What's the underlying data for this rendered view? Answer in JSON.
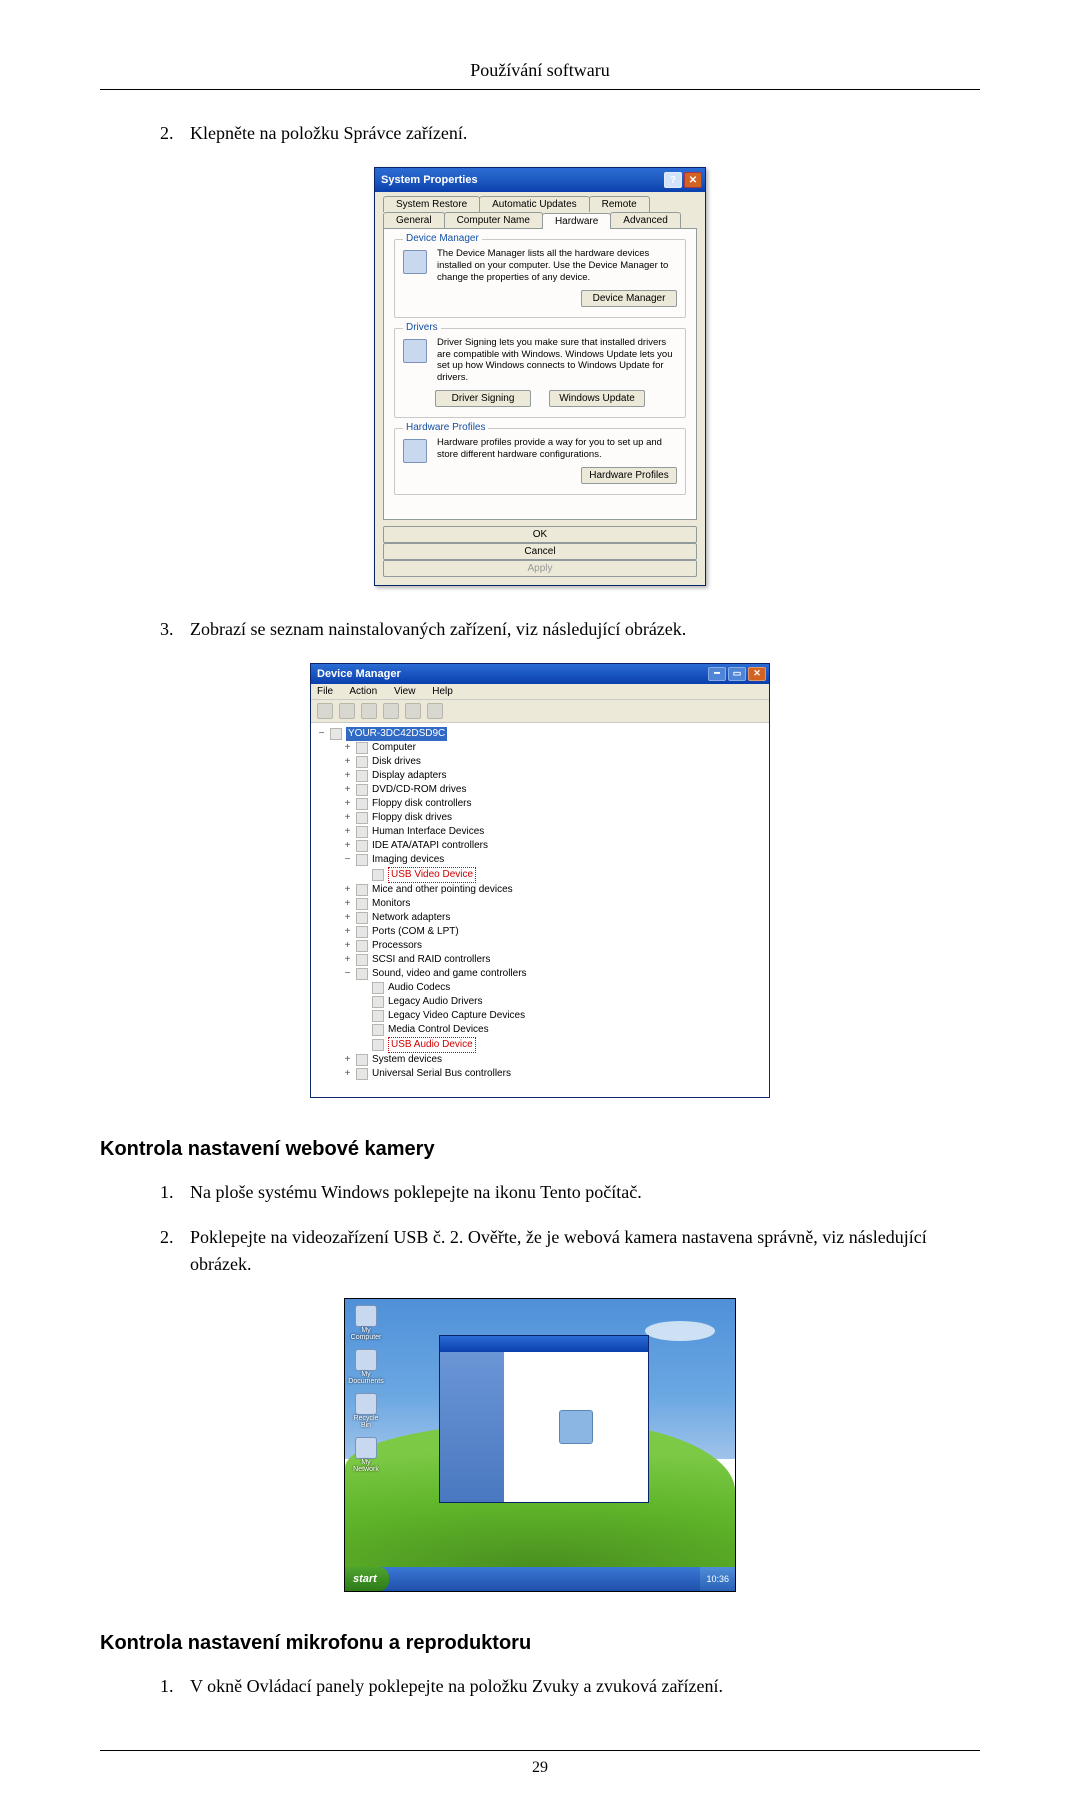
{
  "header": "Používání softwaru",
  "step2": "Klepněte na položku Správce zařízení.",
  "sysprop": {
    "title": "System Properties",
    "tabs_row1": [
      "System Restore",
      "Automatic Updates",
      "Remote"
    ],
    "tabs_row2": [
      "General",
      "Computer Name",
      "Hardware",
      "Advanced"
    ],
    "active_tab": "Hardware",
    "group_devmgr": {
      "label": "Device Manager",
      "text": "The Device Manager lists all the hardware devices installed on your computer. Use the Device Manager to change the properties of any device.",
      "button": "Device Manager"
    },
    "group_drivers": {
      "label": "Drivers",
      "text": "Driver Signing lets you make sure that installed drivers are compatible with Windows. Windows Update lets you set up how Windows connects to Windows Update for drivers.",
      "btn1": "Driver Signing",
      "btn2": "Windows Update"
    },
    "group_hwp": {
      "label": "Hardware Profiles",
      "text": "Hardware profiles provide a way for you to set up and store different hardware configurations.",
      "button": "Hardware Profiles"
    },
    "dlg": {
      "ok": "OK",
      "cancel": "Cancel",
      "apply": "Apply"
    }
  },
  "step3": "Zobrazí se seznam nainstalovaných zařízení, viz následující obrázek.",
  "devmgr": {
    "title": "Device Manager",
    "menu": [
      "File",
      "Action",
      "View",
      "Help"
    ],
    "root": "YOUR-3DC42DSD9C",
    "items": [
      "Computer",
      "Disk drives",
      "Display adapters",
      "DVD/CD-ROM drives",
      "Floppy disk controllers",
      "Floppy disk drives",
      "Human Interface Devices",
      "IDE ATA/ATAPI controllers",
      "Imaging devices"
    ],
    "usb_video": "USB Video Device",
    "items2": [
      "Mice and other pointing devices",
      "Monitors",
      "Network adapters",
      "Ports (COM & LPT)",
      "Processors",
      "SCSI and RAID controllers",
      "Sound, video and game controllers"
    ],
    "svg_children": [
      "Audio Codecs",
      "Legacy Audio Drivers",
      "Legacy Video Capture Devices",
      "Media Control Devices"
    ],
    "usb_audio": "USB Audio Device",
    "items3": [
      "System devices",
      "Universal Serial Bus controllers"
    ]
  },
  "section_camera_heading": "Kontrola nastavení webové kamery",
  "camera_step1": "Na ploše systému Windows poklepejte na ikonu Tento počítač.",
  "camera_step2": "Poklepejte na videozařízení USB č. 2. Ověřte, že je webová kamera nastavena správně, viz následující obrázek.",
  "xp": {
    "start": "start",
    "time": "10:36",
    "icons": [
      "My Computer",
      "My Documents",
      "Recycle Bin",
      "My Network"
    ]
  },
  "section_mic_heading": "Kontrola nastavení mikrofonu a reproduktoru",
  "mic_step1": "V okně Ovládací panely poklepejte na položku Zvuky a zvuková zařízení.",
  "page_number": "29"
}
